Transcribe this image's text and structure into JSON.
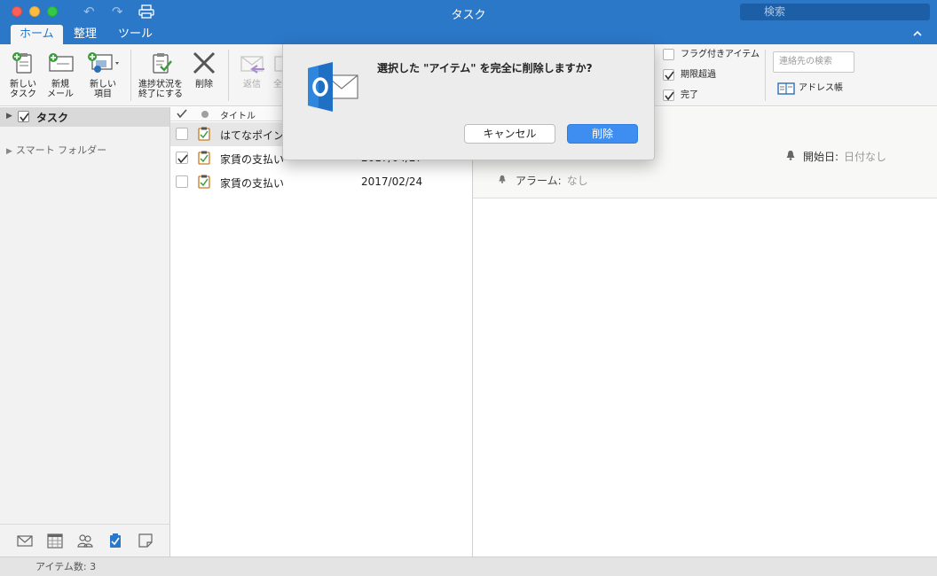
{
  "window": {
    "title": "タスク"
  },
  "search": {
    "placeholder": "検索"
  },
  "tabs": [
    {
      "label": "ホーム",
      "active": true
    },
    {
      "label": "整理",
      "active": false
    },
    {
      "label": "ツール",
      "active": false
    }
  ],
  "ribbon": {
    "new_task": "新しい\nタスク",
    "new_mail": "新規\nメール",
    "new_item": "新しい\n項目",
    "mark_complete": "進捗状況を\n終了にする",
    "delete": "削除",
    "reply": "返信",
    "reply_all_partial": "全",
    "flagged_items": "フラグ付きアイテム",
    "overdue": "期限超過",
    "completed": "完了",
    "contact_search_placeholder": "連絡先の検索",
    "address_book": "アドレス帳"
  },
  "sidebar": {
    "tasks_label": "タスク",
    "smart_folders_label": "スマート フォルダー"
  },
  "list": {
    "header_title": "タイトル",
    "rows": [
      {
        "title": "はてなポイン",
        "date": "",
        "checked": false,
        "selected": true
      },
      {
        "title": "家賃の支払い",
        "date": "2017/04/27",
        "checked": true,
        "selected": false
      },
      {
        "title": "家賃の支払い",
        "date": "2017/02/24",
        "checked": false,
        "selected": false
      }
    ]
  },
  "reading": {
    "start_date_label": "開始日:",
    "start_date_value": "日付なし",
    "alarm_label": "アラーム:",
    "alarm_value": "なし"
  },
  "status": {
    "item_count": "アイテム数: 3"
  },
  "dialog": {
    "message": "選択した \"アイテム\" を完全に削除しますか?",
    "cancel_label": "キャンセル",
    "delete_label": "削除"
  },
  "colors": {
    "accent": "#2b78c8",
    "primary_button": "#3d8ef0",
    "outlook_logo": "#1f6fc5"
  },
  "icons": {
    "undo": "undo-icon",
    "redo": "redo-icon",
    "print": "print-icon",
    "search": "search-icon",
    "nav": [
      "mail-icon",
      "calendar-icon",
      "people-icon",
      "tasks-icon",
      "notes-icon"
    ]
  }
}
